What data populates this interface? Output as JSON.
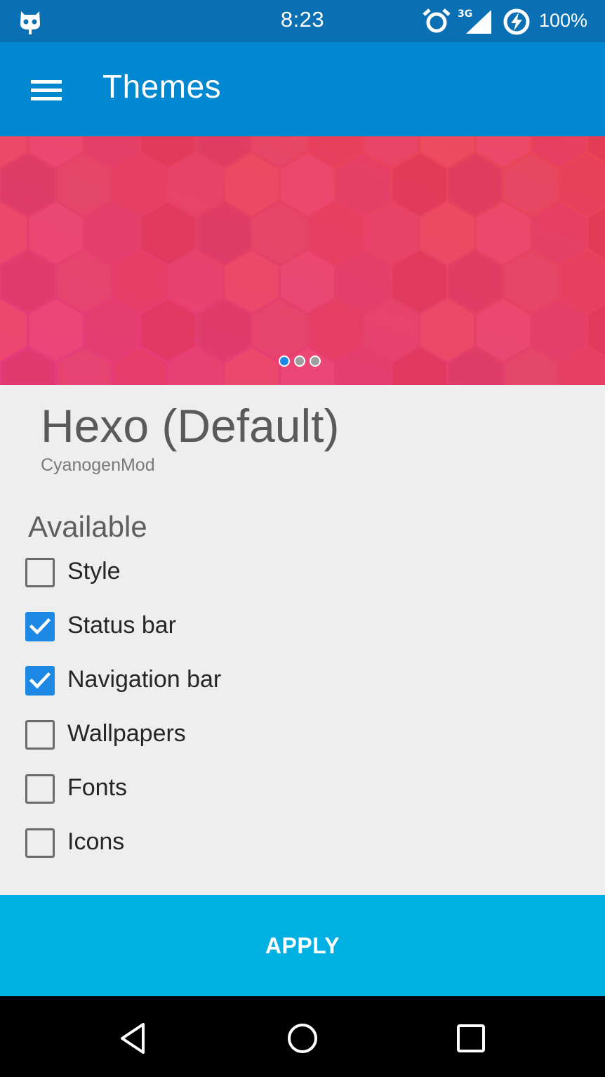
{
  "status_bar": {
    "time": "8:23",
    "network_type": "3G",
    "battery_percent": "100%",
    "icons": [
      "cyanogenmod-logo-icon",
      "alarm-icon",
      "signal-icon",
      "battery-charging-icon"
    ]
  },
  "app_bar": {
    "title": "Themes",
    "menu_icon": "hamburger-menu-icon"
  },
  "preview": {
    "page_count": 3,
    "active_page": 1,
    "colors": {
      "pink": "#e83a82",
      "red": "#ea4552"
    }
  },
  "theme": {
    "name": "Hexo (Default)",
    "author": "CyanogenMod"
  },
  "components": {
    "heading": "Available",
    "items": [
      {
        "label": "Style",
        "checked": false
      },
      {
        "label": "Status bar",
        "checked": true
      },
      {
        "label": "Navigation bar",
        "checked": true
      },
      {
        "label": "Wallpapers",
        "checked": false
      },
      {
        "label": "Fonts",
        "checked": false
      },
      {
        "label": "Icons",
        "checked": false
      }
    ]
  },
  "apply_button": {
    "label": "APPLY"
  },
  "nav_bar": {
    "icons": [
      "back-icon",
      "home-icon",
      "recents-icon"
    ]
  },
  "colors": {
    "status_bar": "#0a6fb3",
    "app_bar": "#0288d1",
    "apply": "#00b0e3",
    "checkbox_checked": "#1e88e5",
    "background": "#eeeeee"
  }
}
